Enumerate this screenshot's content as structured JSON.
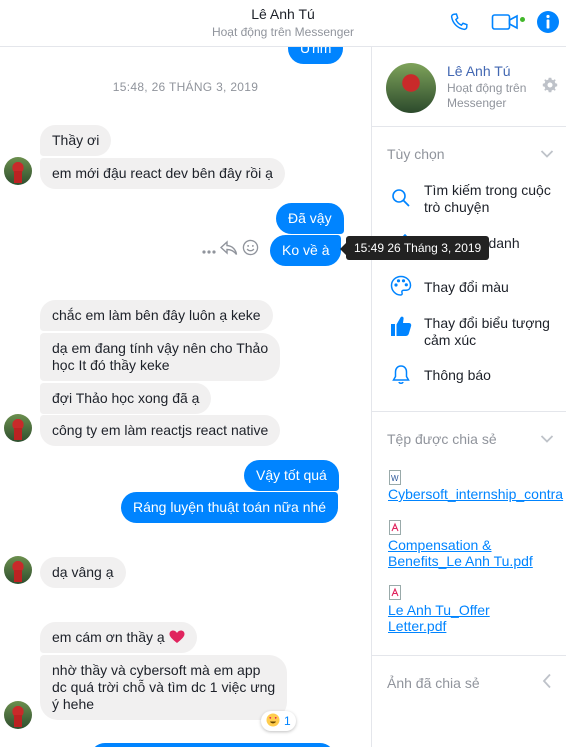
{
  "header": {
    "name": "Lê Anh Tú",
    "status": "Hoạt động trên Messenger",
    "icons": [
      "phone-icon",
      "video-camera-icon",
      "info-icon"
    ]
  },
  "chat": {
    "partial_top_bubble": "Ừhm",
    "timestamp": "15:48, 26 THÁNG 3, 2019",
    "messages": [
      "Thầy ơi",
      "em mới đậu react dev bên đây rồi ạ",
      "Đã vậy",
      "Ko về à",
      "chắc em làm bên đây luôn ạ keke",
      "dạ em đang tính vậy nên cho Thảo",
      "học It đó thầy keke",
      "đợi Thảo học xong đã ạ",
      "công ty em làm reactjs react native",
      "Vậy tốt quá",
      "Ráng luyện thuật toán nữa nhé",
      "dạ vâng ạ",
      "em cám ơn thầy ạ",
      "nhờ thầy và cybersoft mà em app",
      "dc quá trời chỗ và tìm dc 1 việc ưng",
      "ý hehe"
    ],
    "tooltip": "15:49 26 Tháng 3, 2019",
    "reaction_count": "1"
  },
  "panel": {
    "name": "Lê Anh Tú",
    "status_line1": "Hoạt động trên",
    "status_line2": "Messenger",
    "options_title": "Tùy chọn",
    "options": [
      {
        "line1": "Tìm kiếm trong cuộc",
        "line2": "trò chuyện",
        "icon": "search-icon"
      },
      {
        "line1": "biệt danh",
        "line2": "",
        "icon": "pencil-icon"
      },
      {
        "line1": "Thay đổi màu",
        "line2": "",
        "icon": "palette-icon"
      },
      {
        "line1": "Thay đổi biểu tượng",
        "line2": "cảm xúc",
        "icon": "thumbs-up-icon"
      },
      {
        "line1": "Thông báo",
        "line2": "",
        "icon": "bell-icon"
      }
    ],
    "files_title": "Tệp được chia sẻ",
    "files": [
      {
        "line1": "Cybersoft_internship_contra",
        "line2": "",
        "type": "word"
      },
      {
        "line1": "Compensation &",
        "line2": "Benefits_Le Anh Tu.pdf",
        "type": "pdf"
      },
      {
        "line1": "Le Anh Tu_Offer",
        "line2": "Letter.pdf",
        "type": "pdf"
      }
    ],
    "photos_title": "Ảnh đã chia sẻ"
  },
  "colors": {
    "accent": "#0084ff",
    "incoming": "#f1f0f0",
    "online": "#42b72a"
  }
}
